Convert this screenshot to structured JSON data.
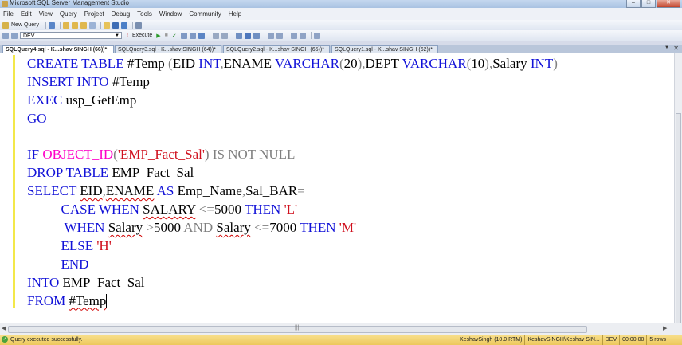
{
  "window": {
    "title": "Microsoft SQL Server Management Studio"
  },
  "menu": [
    "File",
    "Edit",
    "View",
    "Query",
    "Project",
    "Debug",
    "Tools",
    "Window",
    "Community",
    "Help"
  ],
  "toolbar": {
    "new_query": "New Query",
    "database": "DEV",
    "execute": "Execute"
  },
  "tabs": [
    {
      "label": "SQLQuery4.sql - K...shav SINGH (66))*",
      "active": true
    },
    {
      "label": "SQLQuery3.sql - K...shav SINGH (64))*",
      "active": false
    },
    {
      "label": "SQLQuery2.sql - K...shav SINGH (65))*",
      "active": false
    },
    {
      "label": "SQLQuery1.sql - K...shav SINGH (62))*",
      "active": false
    }
  ],
  "code": [
    [
      [
        "kw",
        "CREATE TABLE"
      ],
      [
        "n",
        " #Temp "
      ],
      [
        "op",
        "("
      ],
      [
        "n",
        "EID "
      ],
      [
        "kw",
        "INT"
      ],
      [
        "op",
        ","
      ],
      [
        "n",
        "ENAME "
      ],
      [
        "kw",
        "VARCHAR"
      ],
      [
        "op",
        "("
      ],
      [
        "n",
        "20"
      ],
      [
        "op",
        "),"
      ],
      [
        "n",
        "DEPT "
      ],
      [
        "kw",
        "VARCHAR"
      ],
      [
        "op",
        "("
      ],
      [
        "n",
        "10"
      ],
      [
        "op",
        "),"
      ],
      [
        "n",
        "Salary "
      ],
      [
        "kw",
        "INT"
      ],
      [
        "op",
        ")"
      ]
    ],
    [
      [
        "kw",
        "INSERT INTO"
      ],
      [
        "n",
        " #Temp"
      ]
    ],
    [
      [
        "kw",
        "EXEC"
      ],
      [
        "n",
        " usp_GetEmp"
      ]
    ],
    [
      [
        "kw",
        "GO"
      ]
    ],
    [],
    [
      [
        "kw",
        "IF"
      ],
      [
        "n",
        " "
      ],
      [
        "fn",
        "OBJECT_ID"
      ],
      [
        "op",
        "("
      ],
      [
        "str",
        "'EMP_Fact_Sal'"
      ],
      [
        "op",
        ")"
      ],
      [
        "n",
        " "
      ],
      [
        "op",
        "IS NOT NULL"
      ]
    ],
    [
      [
        "kw",
        "DROP TABLE"
      ],
      [
        "n",
        " EMP_Fact_Sal"
      ]
    ],
    [
      [
        "kw",
        "SELECT"
      ],
      [
        "n",
        " "
      ],
      [
        "sq",
        "EID"
      ],
      [
        "op",
        ","
      ],
      [
        "sq",
        "ENAME"
      ],
      [
        "n",
        " "
      ],
      [
        "kw",
        "AS"
      ],
      [
        "n",
        " Emp_Name"
      ],
      [
        "op",
        ","
      ],
      [
        "n",
        "Sal_BAR"
      ],
      [
        "op",
        "="
      ]
    ],
    [
      [
        "n",
        "          "
      ],
      [
        "kw",
        "CASE WHEN"
      ],
      [
        "n",
        " "
      ],
      [
        "sq",
        "SALARY"
      ],
      [
        "n",
        " "
      ],
      [
        "op",
        "<="
      ],
      [
        "n",
        "5000 "
      ],
      [
        "kw",
        "THEN"
      ],
      [
        "n",
        " "
      ],
      [
        "str",
        "'L'"
      ]
    ],
    [
      [
        "n",
        "           "
      ],
      [
        "kw",
        "WHEN"
      ],
      [
        "n",
        " "
      ],
      [
        "sq",
        "Salary"
      ],
      [
        "n",
        " "
      ],
      [
        "op",
        ">"
      ],
      [
        "n",
        "5000 "
      ],
      [
        "op",
        "AND"
      ],
      [
        "n",
        " "
      ],
      [
        "sq",
        "Salary"
      ],
      [
        "n",
        " "
      ],
      [
        "op",
        "<="
      ],
      [
        "n",
        "7000 "
      ],
      [
        "kw",
        "THEN"
      ],
      [
        "n",
        " "
      ],
      [
        "str",
        "'M'"
      ]
    ],
    [
      [
        "n",
        "          "
      ],
      [
        "kw",
        "ELSE"
      ],
      [
        "n",
        " "
      ],
      [
        "str",
        "'H'"
      ]
    ],
    [
      [
        "n",
        "          "
      ],
      [
        "kw",
        "END"
      ]
    ],
    [
      [
        "kw",
        "INTO"
      ],
      [
        "n",
        " EMP_Fact_Sal"
      ]
    ],
    [
      [
        "kw",
        "FROM"
      ],
      [
        "n",
        " "
      ],
      [
        "sq",
        "#Temp"
      ]
    ]
  ],
  "status": {
    "message": "Query executed successfully.",
    "server": "KeshavSingh (10.0 RTM)",
    "user": "KeshavSINGH\\Keshav SIN...",
    "db": "DEV",
    "time": "00:00:00",
    "rows": "5 rows"
  }
}
